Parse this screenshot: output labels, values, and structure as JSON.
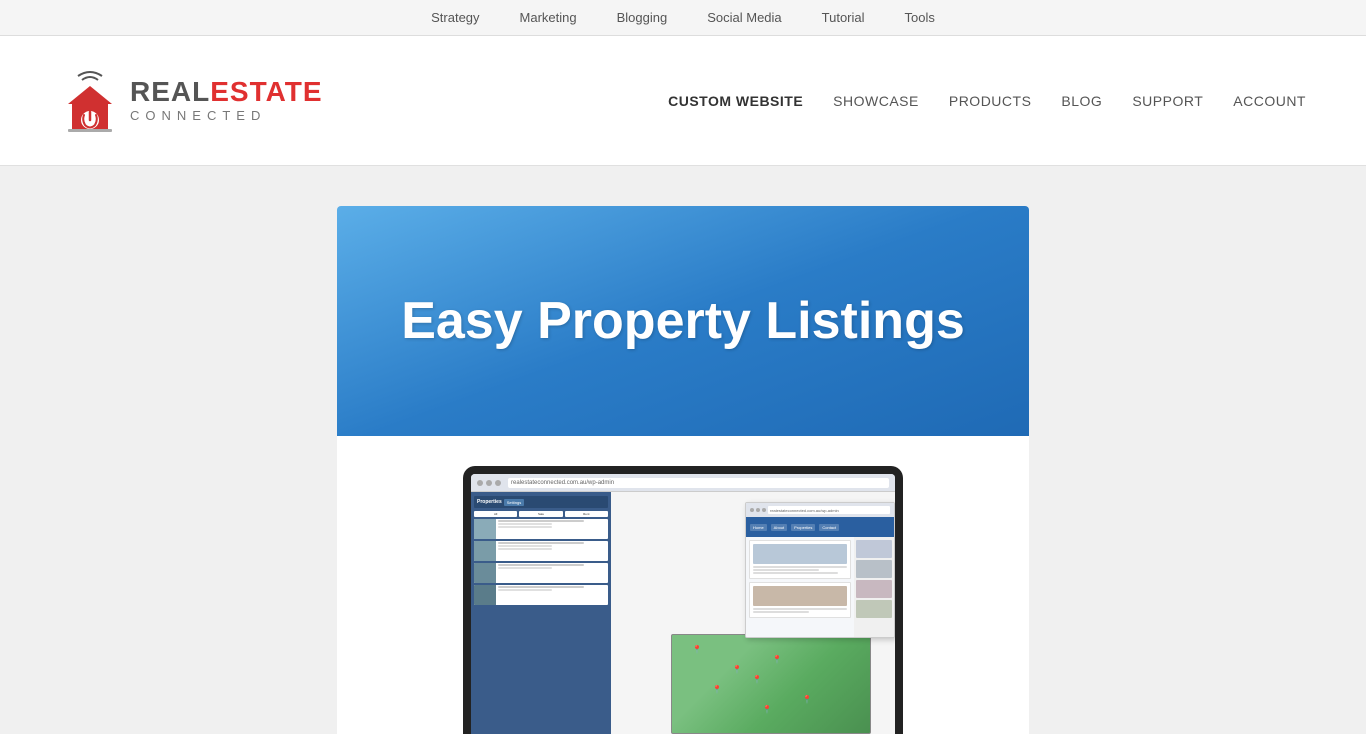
{
  "topBar": {
    "items": [
      {
        "label": "Strategy",
        "id": "strategy"
      },
      {
        "label": "Marketing",
        "id": "marketing"
      },
      {
        "label": "Blogging",
        "id": "blogging"
      },
      {
        "label": "Social Media",
        "id": "social-media"
      },
      {
        "label": "Tutorial",
        "id": "tutorial"
      },
      {
        "label": "Tools",
        "id": "tools"
      }
    ]
  },
  "header": {
    "logo": {
      "real": "REAL",
      "estate": "ESTATE",
      "connected": "CONNECTED"
    },
    "nav": [
      {
        "label": "CUSTOM WEBSITE",
        "id": "custom-website",
        "active": true
      },
      {
        "label": "SHOWCASE",
        "id": "showcase"
      },
      {
        "label": "PRODUCTS",
        "id": "products"
      },
      {
        "label": "BLOG",
        "id": "blog"
      },
      {
        "label": "SUPPORT",
        "id": "support"
      },
      {
        "label": "ACCOUNT",
        "id": "account"
      }
    ]
  },
  "hero": {
    "title": "Easy Property Listings"
  },
  "mockup": {
    "browserUrl": "realestateconnected.com.au/wp-admin",
    "floatUrl": "realestateconnected.com.au/wp-admin"
  }
}
